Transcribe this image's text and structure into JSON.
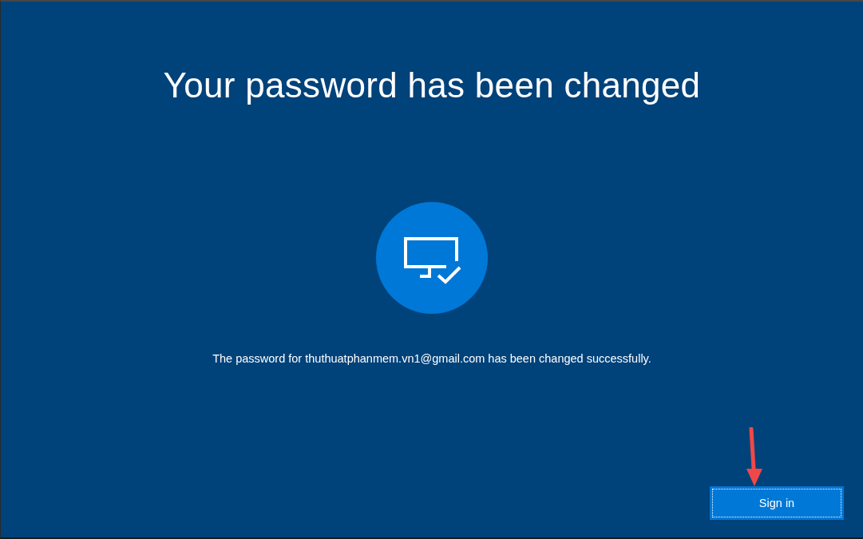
{
  "title": "Your password has been changed",
  "message": "The password for thuthuatphanmem.vn1@gmail.com has been changed successfully.",
  "sign_in_button": {
    "label": "Sign in",
    "focused": true
  }
}
